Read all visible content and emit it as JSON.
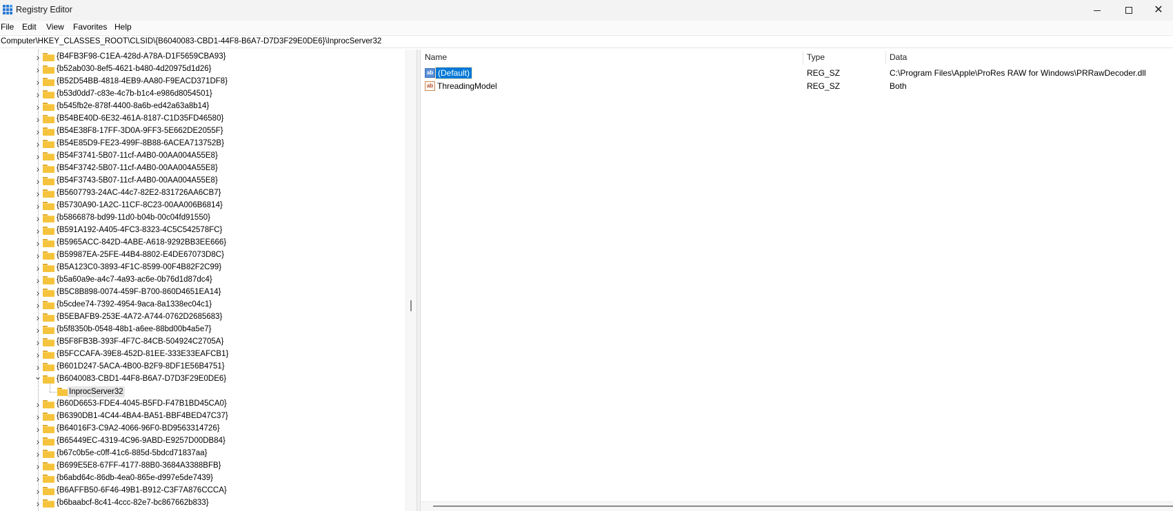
{
  "window": {
    "title": "Registry Editor",
    "controls": {
      "minimize": "minimize",
      "maximize": "maximize",
      "close": "✕"
    }
  },
  "menu": [
    "File",
    "Edit",
    "View",
    "Favorites",
    "Help"
  ],
  "address": "Computer\\HKEY_CLASSES_ROOT\\CLSID\\{B6040083-CBD1-44F8-B6A7-D7D3F29E0DE6}\\InprocServer32",
  "tree": {
    "items": [
      "{B4FB3F98-C1EA-428d-A78A-D1F5659CBA93}",
      "{b52ab030-8ef5-4621-b480-4d20975d1d26}",
      "{B52D54BB-4818-4EB9-AA80-F9EACD371DF8}",
      "{b53d0dd7-c83e-4c7b-b1c4-e986d8054501}",
      "{b545fb2e-878f-4400-8a6b-ed42a63a8b14}",
      "{B54BE40D-6E32-461A-8187-C1D35FD46580}",
      "{B54E38F8-17FF-3D0A-9FF3-5E662DE2055F}",
      "{B54E85D9-FE23-499F-8B88-6ACEA713752B}",
      "{B54F3741-5B07-11cf-A4B0-00AA004A55E8}",
      "{B54F3742-5B07-11cf-A4B0-00AA004A55E8}",
      "{B54F3743-5B07-11cf-A4B0-00AA004A55E8}",
      "{B5607793-24AC-44c7-82E2-831726AA6CB7}",
      "{B5730A90-1A2C-11CF-8C23-00AA006B6814}",
      "{b5866878-bd99-11d0-b04b-00c04fd91550}",
      "{B591A192-A405-4FC3-8323-4C5C542578FC}",
      "{B5965ACC-842D-4ABE-A618-9292BB3EE666}",
      "{B59987EA-25FE-44B4-8802-E4DE67073D8C}",
      "{B5A123C0-3893-4F1C-8599-00F4B82F2C99}",
      "{b5a60a9e-a4c7-4a93-ac6e-0b76d1d87dc4}",
      "{B5C8B898-0074-459F-B700-860D4651EA14}",
      "{b5cdee74-7392-4954-9aca-8a1338ec04c1}",
      "{B5EBAFB9-253E-4A72-A744-0762D2685683}",
      "{b5f8350b-0548-48b1-a6ee-88bd00b4a5e7}",
      "{B5F8FB3B-393F-4F7C-84CB-504924C2705A}",
      "{B5FCCAFA-39E8-452D-81EE-333E33EAFCB1}",
      "{B601D247-5ACA-4B00-B2F9-8DF1E56B4751}",
      "{B6040083-CBD1-44F8-B6A7-D7D3F29E0DE6}",
      "InprocServer32",
      "{B60D6653-FDE4-4045-B5FD-F47B1BD45CA0}",
      "{B6390DB1-4C44-4BA4-BA51-BBF4BED47C37}",
      "{B64016F3-C9A2-4066-96F0-BD9563314726}",
      "{B65449EC-4319-4C96-9ABD-E9257D00DB84}",
      "{b67c0b5e-c0ff-41c6-885d-5bdcd71837aa}",
      "{B699E5E8-67FF-4177-88B0-3684A3388BFB}",
      "{b6abd64c-86db-4ea0-865e-d997e5de7439}",
      "{B6AFFB50-6F46-49B1-B912-C3F7A876CCCA}",
      "{b6baabcf-8c41-4ccc-82e7-bc867662b833}"
    ]
  },
  "list": {
    "headers": {
      "name": "Name",
      "type": "Type",
      "data": "Data"
    },
    "rows": [
      {
        "name": "(Default)",
        "type": "REG_SZ",
        "data": "C:\\Program Files\\Apple\\ProRes RAW for Windows\\PRRawDecoder.dll",
        "icon": "string-value-icon"
      },
      {
        "name": "ThreadingModel",
        "type": "REG_SZ",
        "data": "Both",
        "icon": "string-value-icon"
      }
    ]
  },
  "colors": {
    "selection": "#0078d7",
    "folder": "#f5c33c"
  }
}
